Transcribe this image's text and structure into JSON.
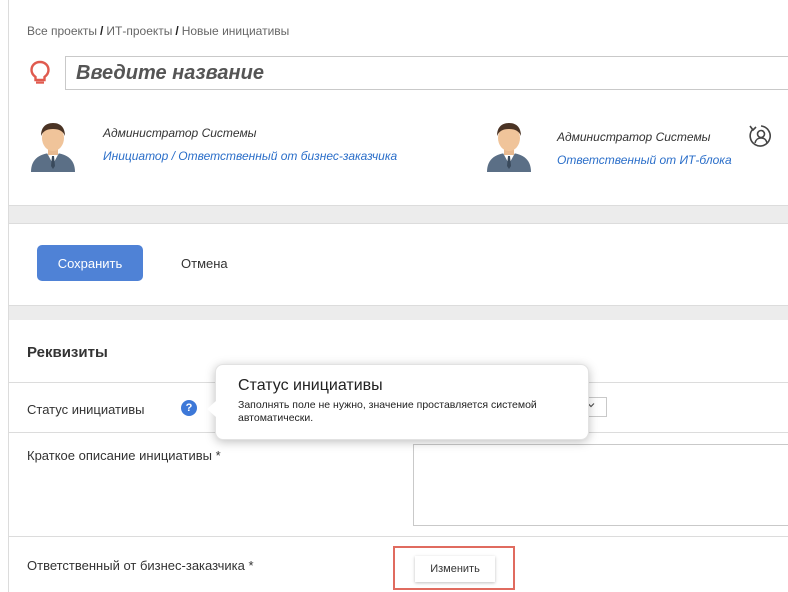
{
  "breadcrumb": {
    "items": [
      "Все проекты",
      "ИТ-проекты",
      "Новые инициативы"
    ],
    "separator": "/"
  },
  "title_input": {
    "placeholder": "Введите название",
    "icon": "lightbulb-icon",
    "icon_color": "#e05a4e"
  },
  "people": [
    {
      "name": "Администратор Системы",
      "role": "Инициатор / Ответственный от бизнес-заказчика"
    },
    {
      "name": "Администратор Системы",
      "role": "Ответственный от ИТ-блока"
    }
  ],
  "actions": {
    "save_label": "Сохранить",
    "cancel_label": "Отмена",
    "save_color": "#4f82d6"
  },
  "details": {
    "title": "Реквизиты",
    "status_label": "Статус инициативы",
    "status_help_icon": "question-icon",
    "short_description_label": "Краткое описание инициативы *",
    "business_owner_label": "Ответственный от бизнес-заказчика *",
    "change_label": "Изменить",
    "highlight_color": "#e06b5f"
  },
  "tooltip": {
    "title": "Статус инициативы",
    "text": "Заполнять поле не нужно, значение проставляется системой автоматически."
  },
  "link_color": "#2a6ec9"
}
